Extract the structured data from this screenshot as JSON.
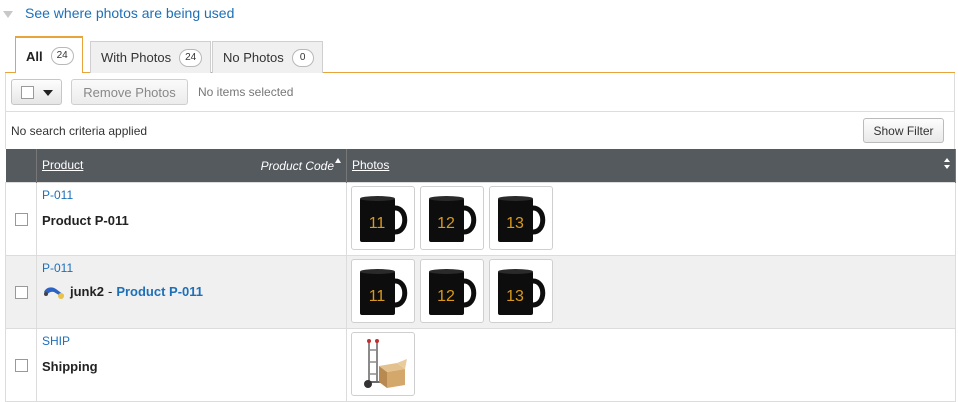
{
  "header": {
    "link_text": "See where photos are being used"
  },
  "tabs": [
    {
      "label": "All",
      "count": "24"
    },
    {
      "label": "With Photos",
      "count": "24"
    },
    {
      "label": "No Photos",
      "count": "0"
    }
  ],
  "toolbar": {
    "remove_label": "Remove Photos",
    "status": "No items selected"
  },
  "filter": {
    "criteria_text": "No search criteria applied",
    "button_label": "Show Filter"
  },
  "table": {
    "columns": {
      "product": "Product",
      "product_code": "Product Code",
      "photos": "Photos"
    },
    "rows": [
      {
        "code": "P-011",
        "name": "Product P-011",
        "photos": [
          "11",
          "12",
          "13"
        ]
      },
      {
        "code": "P-011",
        "prefix": "junk2",
        "separator": "-",
        "link": "Product P-011",
        "photos": [
          "11",
          "12",
          "13"
        ]
      },
      {
        "code": "SHIP",
        "name": "Shipping",
        "photos": [
          "hand-truck"
        ]
      }
    ]
  },
  "colors": {
    "link": "#1d6fb8",
    "accent": "#e8a33a",
    "header_bg": "#555a5f",
    "mug_number": "#d99a1e"
  },
  "icons": [
    "expand-triangle-icon",
    "dropdown-caret-icon",
    "sort-asc-icon",
    "sort-both-icon",
    "tool-icon",
    "hand-truck-icon",
    "mug-icon"
  ]
}
